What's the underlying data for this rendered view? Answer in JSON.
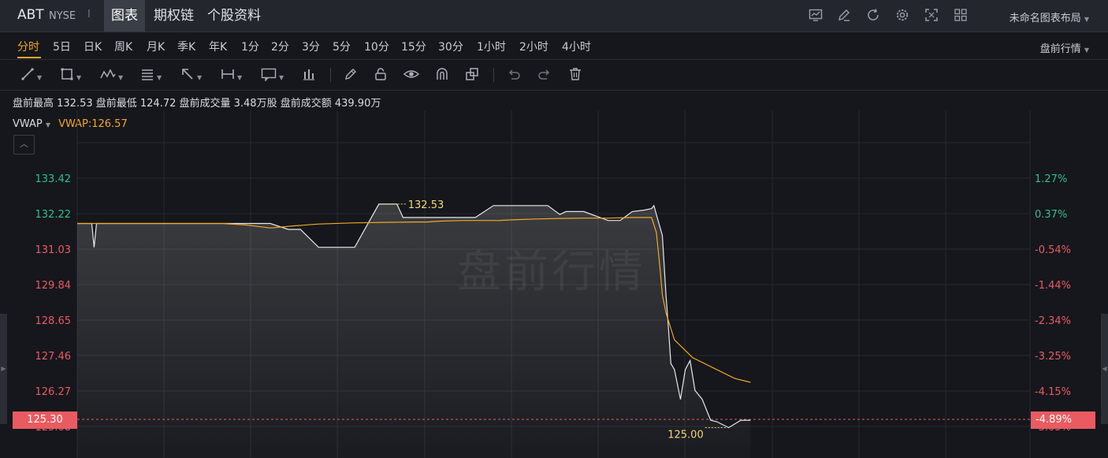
{
  "header": {
    "symbol": "ABT",
    "exchange": "NYSE",
    "separator": "I",
    "tabs": [
      "图表",
      "期权链",
      "个股资料"
    ],
    "layout_name": "未命名图表布局",
    "icons": [
      "chart-settings-icon",
      "draw-icon",
      "refresh-icon",
      "gear-icon",
      "fullscreen-icon",
      "grid-layout-icon"
    ]
  },
  "periods": {
    "items": [
      "分时",
      "5日",
      "日K",
      "周K",
      "月K",
      "季K",
      "年K",
      "1分",
      "2分",
      "3分",
      "5分",
      "10分",
      "15分",
      "30分",
      "1小时",
      "2小时",
      "4小时"
    ],
    "active": "分时",
    "session": "盘前行情"
  },
  "toolbar": {
    "tools": [
      "line-tool-icon",
      "rect-tool-icon",
      "pattern-tool-icon",
      "fib-tool-icon",
      "arrow-tool-icon",
      "measure-tool-icon",
      "annotation-tool-icon",
      "bars-tool-icon",
      "pen-icon",
      "lock-icon",
      "eye-icon",
      "magnet-icon",
      "layers-icon",
      "undo-icon",
      "redo-icon",
      "trash-icon"
    ]
  },
  "stats": {
    "text": "盘前最高 132.53  盘前最低 124.72  盘前成交量 3.48万股  盘前成交额 439.90万"
  },
  "indicator": {
    "name": "VWAP",
    "value": "VWAP:126.57"
  },
  "watermark": "盘前行情",
  "colors": {
    "up": "#2fbf8f",
    "down": "#e95b61",
    "vwap": "#f5a623",
    "price": "#e8e8e8",
    "background": "#15171c"
  },
  "chart_data": {
    "type": "line",
    "y_left_ticks": [
      "133.42",
      "132.22",
      "131.03",
      "129.84",
      "128.65",
      "127.46",
      "126.27",
      "125.08"
    ],
    "y_right_ticks": [
      "1.27%",
      "0.37%",
      "-0.54%",
      "-1.44%",
      "-2.34%",
      "-3.25%",
      "-4.15%",
      "-5.05%"
    ],
    "ylim": [
      124.7,
      134.6
    ],
    "high_label": "132.53",
    "low_label": "125.00",
    "current_price": "125.30",
    "current_change": "-4.89%",
    "series": [
      {
        "name": "VWAP",
        "x": [
          0,
          20,
          40,
          60,
          80,
          100,
          120,
          140,
          150,
          160,
          180,
          200,
          230,
          260,
          280,
          290,
          300,
          320,
          340,
          350,
          360,
          380,
          400,
          420,
          440,
          460,
          470,
          476,
          480,
          483,
          485,
          488,
          495,
          510,
          530,
          545,
          558
        ],
        "y": [
          131.9,
          131.9,
          131.9,
          131.9,
          131.9,
          131.9,
          131.9,
          131.85,
          131.8,
          131.75,
          131.82,
          131.88,
          131.92,
          131.94,
          131.95,
          131.95,
          131.98,
          132.0,
          132.0,
          132.0,
          132.02,
          132.05,
          132.07,
          132.08,
          132.08,
          132.1,
          132.1,
          132.1,
          131.6,
          130.4,
          129.5,
          128.9,
          128.0,
          127.4,
          127.0,
          126.7,
          126.57
        ]
      },
      {
        "name": "Price",
        "x": [
          0,
          12,
          14,
          16,
          17,
          18,
          100,
          160,
          175,
          185,
          200,
          230,
          250,
          255,
          260,
          265,
          270,
          290,
          300,
          330,
          345,
          360,
          370,
          390,
          400,
          405,
          410,
          420,
          440,
          450,
          460,
          470,
          476,
          478,
          480,
          485,
          488,
          490,
          492,
          495,
          500,
          504,
          508,
          512,
          518,
          525,
          530,
          540,
          550,
          558
        ],
        "y": [
          131.9,
          131.9,
          131.1,
          131.9,
          131.9,
          131.9,
          131.9,
          131.9,
          131.7,
          131.7,
          131.1,
          131.1,
          132.55,
          132.55,
          132.55,
          132.55,
          132.1,
          132.1,
          132.1,
          132.1,
          132.5,
          132.5,
          132.5,
          132.5,
          132.2,
          132.3,
          132.3,
          132.3,
          132.0,
          132.0,
          132.3,
          132.35,
          132.4,
          132.5,
          132.2,
          131.5,
          129.5,
          128.4,
          127.2,
          127.0,
          126.0,
          127.0,
          127.3,
          126.3,
          126.0,
          125.3,
          125.25,
          125.05,
          125.3,
          125.3
        ]
      }
    ]
  }
}
